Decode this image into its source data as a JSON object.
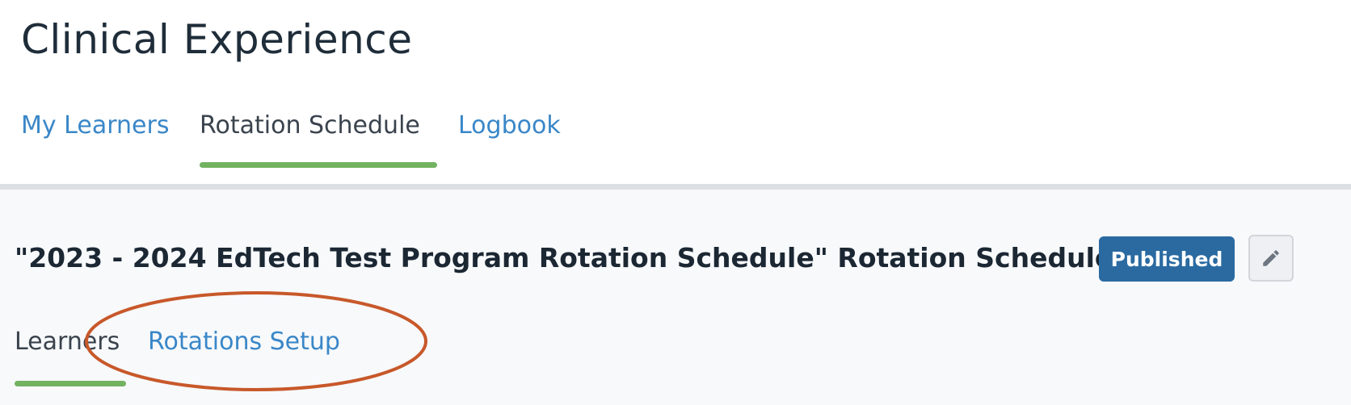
{
  "page": {
    "title": "Clinical Experience"
  },
  "tabs": [
    {
      "label": "My Learners",
      "active": false
    },
    {
      "label": "Rotation Schedule",
      "active": true
    },
    {
      "label": "Logbook",
      "active": false
    }
  ],
  "schedule": {
    "title": "\"2023 - 2024 EdTech Test Program Rotation Schedule\" Rotation Schedule",
    "status": "Published",
    "edit_icon": "pencil-icon"
  },
  "subtabs": [
    {
      "label": "Learners",
      "active": true
    },
    {
      "label": "Rotations Setup",
      "active": false
    }
  ],
  "colors": {
    "link": "#3a87c8",
    "active_underline": "#72b261",
    "badge": "#2a6aa1",
    "annotation": "#c8582a"
  }
}
